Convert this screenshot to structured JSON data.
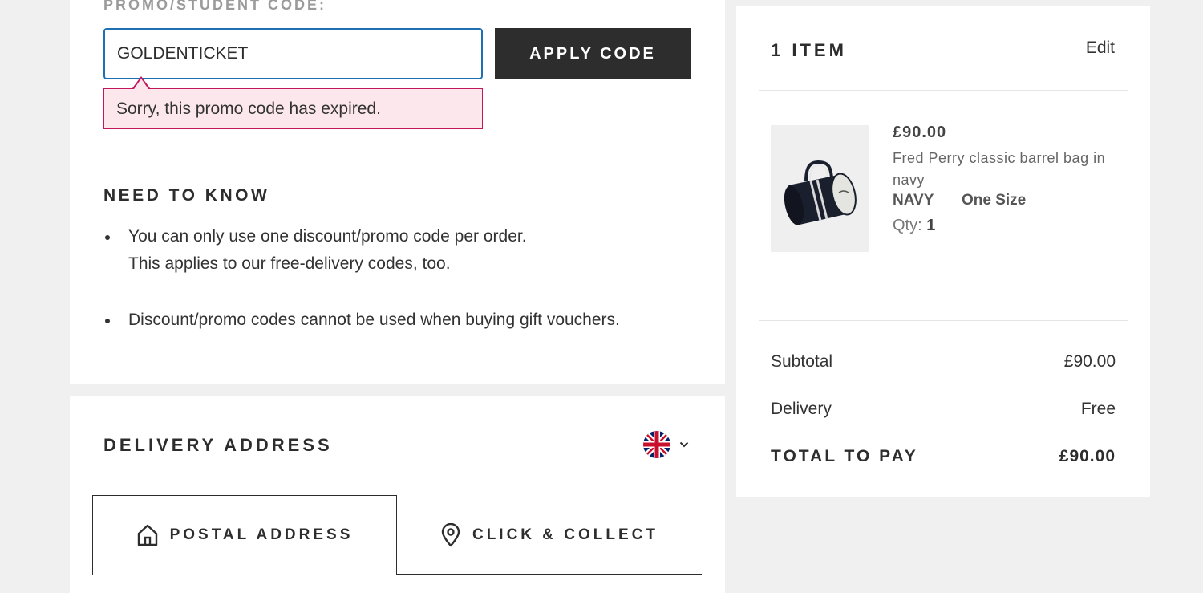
{
  "promo": {
    "label": "PROMO/STUDENT CODE:",
    "input_value": "GOLDENTICKET",
    "apply_label": "APPLY CODE",
    "error_message": "Sorry, this promo code has expired."
  },
  "need_to_know": {
    "heading": "NEED TO KNOW",
    "item1_line1": "You can only use one discount/promo code per order.",
    "item1_line2": "This applies to our free-delivery codes, too.",
    "item2": "Discount/promo codes cannot be used when buying gift vouchers."
  },
  "delivery": {
    "heading": "DELIVERY ADDRESS",
    "country_icon": "uk-flag-icon",
    "tabs": [
      {
        "label": "POSTAL ADDRESS",
        "icon": "home-icon",
        "active": true
      },
      {
        "label": "CLICK & COLLECT",
        "icon": "location-pin-icon",
        "active": false
      }
    ]
  },
  "summary": {
    "item_count": "1 ITEM",
    "edit_label": "Edit",
    "product": {
      "price": "£90.00",
      "name": "Fred Perry classic barrel bag in navy",
      "colour": "NAVY",
      "size": "One Size",
      "qty_label": "Qty:",
      "qty_value": "1"
    },
    "subtotal_label": "Subtotal",
    "subtotal_value": "£90.00",
    "delivery_label": "Delivery",
    "delivery_value": "Free",
    "total_label": "TOTAL TO PAY",
    "total_value": "£90.00"
  },
  "colors": {
    "input_border": "#1f6fb5",
    "error_border": "#c2185b",
    "error_bg": "#fce7ec",
    "button_bg": "#2d2d2d"
  }
}
